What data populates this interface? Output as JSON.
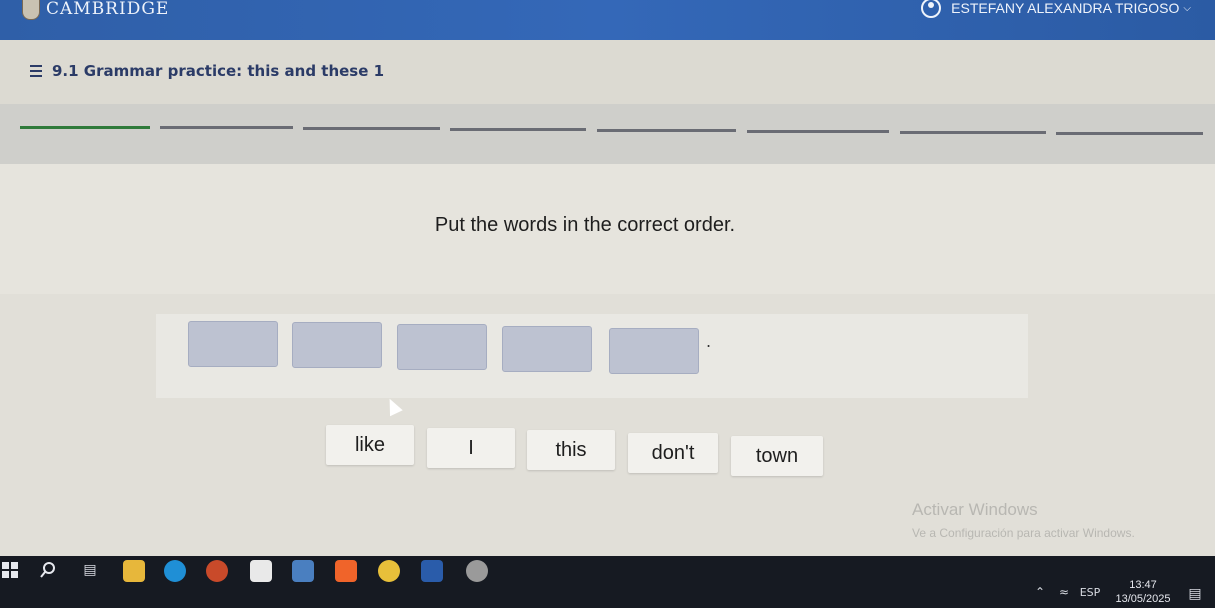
{
  "header": {
    "brand": "CAMBRIDGE",
    "user_name": "ESTEFANY ALEXANDRA TRIGOSO",
    "user_menu_icon": "chevron-down-icon"
  },
  "activity": {
    "title": "9.1 Grammar practice: this and these 1",
    "progress_segments": 8,
    "completed_segments": 1
  },
  "exercise": {
    "instruction": "Put the words in the correct order.",
    "answer_slot_count": 5,
    "sentence_end": ".",
    "word_tiles": [
      "like",
      "I",
      "this",
      "don't",
      "town"
    ]
  },
  "watermark": {
    "title": "Activar Windows",
    "subtitle": "Ve a Configuración para activar Windows."
  },
  "taskbar": {
    "language": "ESP",
    "time": "13:47",
    "date": "13/05/2025",
    "apps": [
      "start-icon",
      "search-icon",
      "task-view-icon",
      "file-explorer-icon",
      "edge-icon",
      "powerpoint-icon",
      "calendar-icon",
      "photos-icon",
      "brave-icon",
      "chrome-icon",
      "word-icon",
      "chrome-profile-icon"
    ]
  },
  "colors": {
    "header_bg": "#3266b4",
    "slot_fill": "#bdc2d1",
    "progress_done": "#2f7a3a",
    "taskbar_bg": "#161a22"
  }
}
